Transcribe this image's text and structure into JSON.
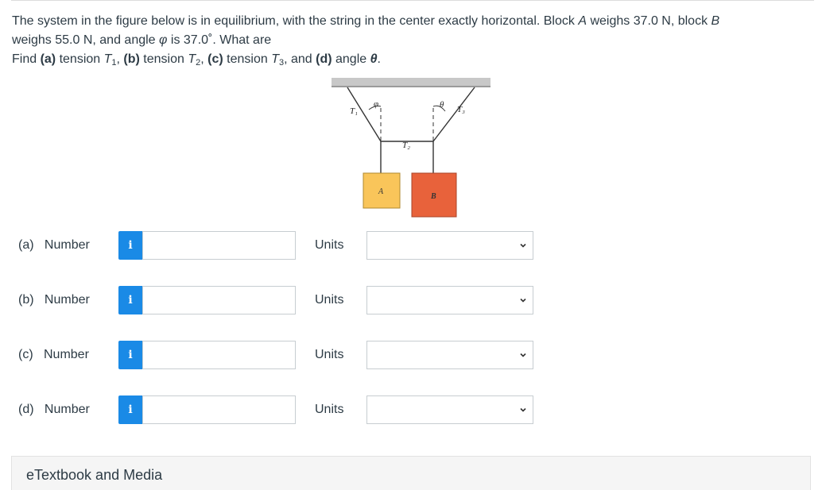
{
  "question": {
    "line1": "The system in the figure below is in equilibrium, with the string in the center exactly horizontal. Block ",
    "block_a": "A",
    "line1_mid": " weighs 37.0 N, block ",
    "block_b": "B",
    "line2_start": "weighs 55.0 N, and angle ",
    "phi": "φ",
    "line2_end": " is 37.0˚. What are",
    "find": "Find ",
    "part_a": "(a)",
    "tension_t1": " tension ",
    "t": "T",
    "sub1": "1",
    "sep1": ", ",
    "part_b": "(b)",
    "sub2": "2",
    "part_c": "(c)",
    "sub3": "3",
    "and_text": ", and ",
    "part_d": "(d)",
    "angle_text": " angle ",
    "theta": "θ",
    "period": "."
  },
  "figure": {
    "label_t1": "T₁",
    "label_phi": "φ",
    "label_theta": "θ",
    "label_t3": "T₃",
    "label_t2": "T₂",
    "label_a": "A",
    "label_b": "B",
    "colors": {
      "ceiling": "#c8c8c8",
      "block_a": "#f9c55a",
      "block_b": "#e8623b",
      "string": "#333333"
    }
  },
  "answers": [
    {
      "part": "(a)",
      "label": "Number",
      "info_icon": "i",
      "value": "",
      "units_label": "Units",
      "units_value": ""
    },
    {
      "part": "(b)",
      "label": "Number",
      "info_icon": "i",
      "value": "",
      "units_label": "Units",
      "units_value": ""
    },
    {
      "part": "(c)",
      "label": "Number",
      "info_icon": "i",
      "value": "",
      "units_label": "Units",
      "units_value": ""
    },
    {
      "part": "(d)",
      "label": "Number",
      "info_icon": "i",
      "value": "",
      "units_label": "Units",
      "units_value": ""
    }
  ],
  "etextbook": {
    "label": "eTextbook and Media"
  },
  "colors": {
    "info_button": "#1a8ae6",
    "text": "#2d3b45",
    "border": "#c7cdd1"
  }
}
